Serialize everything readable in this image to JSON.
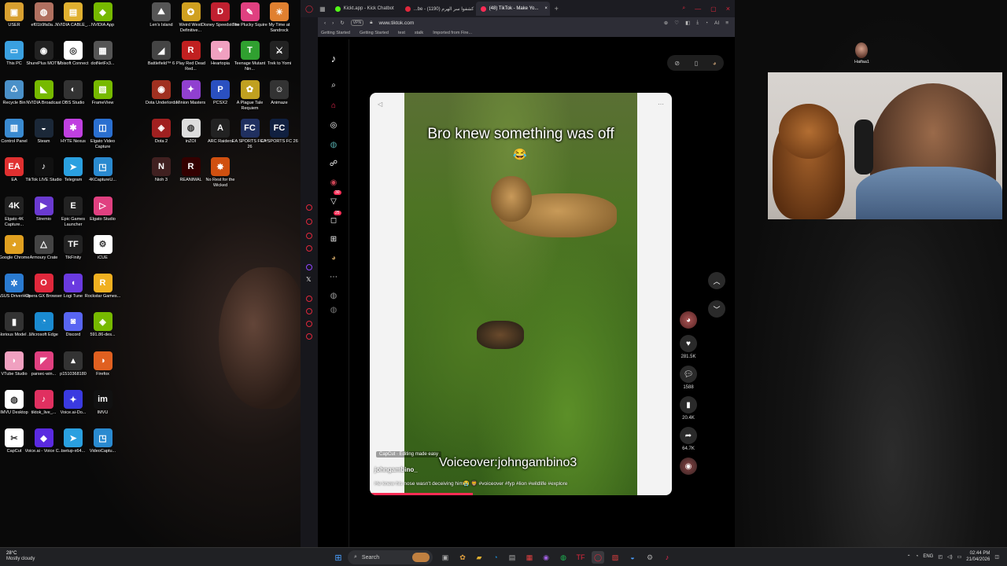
{
  "desktop": {
    "icons": [
      {
        "label": "USER",
        "color": "#d8a030",
        "glyph": "▣"
      },
      {
        "label": "ef01b9fa0a...",
        "color": "#b07060",
        "glyph": "◍"
      },
      {
        "label": "NVIDIA CABLE_...",
        "color": "#e0b030",
        "glyph": "▤"
      },
      {
        "label": "NVIDIA App",
        "color": "#76b900",
        "glyph": "◆"
      },
      {
        "label": "This PC",
        "color": "#3aa0e0",
        "glyph": "▭"
      },
      {
        "label": "ShurePlus MOTIV",
        "color": "#222",
        "glyph": "◉"
      },
      {
        "label": "Ubisoft Connect",
        "color": "#fff",
        "glyph": "◎"
      },
      {
        "label": "dotNetFx3...",
        "color": "#555",
        "glyph": "▦"
      },
      {
        "label": "Recycle Bin",
        "color": "#4a90c8",
        "glyph": "♺"
      },
      {
        "label": "NVIDIA Broadcast",
        "color": "#76b900",
        "glyph": "◣"
      },
      {
        "label": "OBS Studio",
        "color": "#333",
        "glyph": "◐"
      },
      {
        "label": "FrameView",
        "color": "#76b900",
        "glyph": "▧"
      },
      {
        "label": "Control Panel",
        "color": "#3a8ad0",
        "glyph": "▥"
      },
      {
        "label": "Steam",
        "color": "#1b2838",
        "glyph": "◒"
      },
      {
        "label": "HYTE Nexus",
        "color": "#c040e0",
        "glyph": "✱"
      },
      {
        "label": "Elgato Video Capture",
        "color": "#2a6fd0",
        "glyph": "◫"
      },
      {
        "label": "EA",
        "color": "#e03030",
        "glyph": "EA"
      },
      {
        "label": "TikTok LIVE Studio",
        "color": "#111",
        "glyph": "♪"
      },
      {
        "label": "Telegram",
        "color": "#2aa0e0",
        "glyph": "➤"
      },
      {
        "label": "4KCaptureU...",
        "color": "#2a8ad0",
        "glyph": "◳"
      },
      {
        "label": "Elgato 4K Capture...",
        "color": "#222",
        "glyph": "4K"
      },
      {
        "label": "Stremio",
        "color": "#6a3ad0",
        "glyph": "▶"
      },
      {
        "label": "Epic Games Launcher",
        "color": "#222",
        "glyph": "E"
      },
      {
        "label": "Elgato Studio",
        "color": "#e04080",
        "glyph": "▷"
      },
      {
        "label": "Google Chrome",
        "color": "#e0a020",
        "glyph": "◕"
      },
      {
        "label": "Armoury Crate",
        "color": "#444",
        "glyph": "△"
      },
      {
        "label": "TikFinity",
        "color": "#222",
        "glyph": "TF"
      },
      {
        "label": "iCUE",
        "color": "#fff",
        "glyph": "⚙"
      },
      {
        "label": "ASUS DriverHub",
        "color": "#2a7ad0",
        "glyph": "✲"
      },
      {
        "label": "Opera GX Browser",
        "color": "#e0283c",
        "glyph": "O"
      },
      {
        "label": "Logi Tune",
        "color": "#6a3ae0",
        "glyph": "◖"
      },
      {
        "label": "Rockstar Games...",
        "color": "#f0b020",
        "glyph": "R"
      },
      {
        "label": "Glorious Model ...",
        "color": "#333",
        "glyph": "▮"
      },
      {
        "label": "Microsoft Edge",
        "color": "#1a8ad0",
        "glyph": "◔"
      },
      {
        "label": "Discord",
        "color": "#5865f2",
        "glyph": "◙"
      },
      {
        "label": "591.86-des...",
        "color": "#76b900",
        "glyph": "◈"
      },
      {
        "label": "VTube Studio",
        "color": "#f0a0c0",
        "glyph": "◗"
      },
      {
        "label": "parsec-win...",
        "color": "#e04080",
        "glyph": "◤"
      },
      {
        "label": "p1510368180",
        "color": "#333",
        "glyph": "▴"
      },
      {
        "label": "Firefox",
        "color": "#e06020",
        "glyph": "◑"
      },
      {
        "label": "IMVU Desktop",
        "color": "#fff",
        "glyph": "◍"
      },
      {
        "label": "tiktok_live_...",
        "color": "#e03060",
        "glyph": "♪"
      },
      {
        "label": "Voice.ai-Do...",
        "color": "#3a3ae0",
        "glyph": "✦"
      },
      {
        "label": "IMVU",
        "color": "#111",
        "glyph": "im"
      },
      {
        "label": "CapCut",
        "color": "#fff",
        "glyph": "✂"
      },
      {
        "label": "Voice.ai - Voice C...",
        "color": "#5a2ae0",
        "glyph": "◆"
      },
      {
        "label": "tsetup-x64...",
        "color": "#2aa0e0",
        "glyph": "➤"
      },
      {
        "label": "VideoCaptu...",
        "color": "#2a8ad0",
        "glyph": "◳"
      }
    ],
    "icons2": [
      {
        "label": "Len's Island",
        "color": "#555",
        "glyph": "⛰"
      },
      {
        "label": "Weird West: Definitive...",
        "color": "#d0a020",
        "glyph": "✪"
      },
      {
        "label": "Disney Speedstorm",
        "color": "#c02030",
        "glyph": "D"
      },
      {
        "label": "The Plucky Squire",
        "color": "#e04080",
        "glyph": "✎"
      },
      {
        "label": "My Time at Sandrock",
        "color": "#e08030",
        "glyph": "☀"
      },
      {
        "label": "Battlefield™ 6",
        "color": "#444",
        "glyph": "◢"
      },
      {
        "label": "Play Red Dead Red...",
        "color": "#c02020",
        "glyph": "R"
      },
      {
        "label": "Heartopia",
        "color": "#f0a0c0",
        "glyph": "♥"
      },
      {
        "label": "Teenage Mutant Nin...",
        "color": "#30a030",
        "glyph": "T"
      },
      {
        "label": "Trek to Yomi",
        "color": "#222",
        "glyph": "⚔"
      },
      {
        "label": "Dota Underlords",
        "color": "#a03020",
        "glyph": "◉"
      },
      {
        "label": "Minion Masters",
        "color": "#9040d0",
        "glyph": "✦"
      },
      {
        "label": "PCSX2",
        "color": "#2a50c0",
        "glyph": "P"
      },
      {
        "label": "A Plague Tale Requiem",
        "color": "#c0a020",
        "glyph": "✿"
      },
      {
        "label": "Animaze",
        "color": "#333",
        "glyph": "☺"
      },
      {
        "label": "Dota 2",
        "color": "#a02020",
        "glyph": "◈"
      },
      {
        "label": "inZOI",
        "color": "#ddd",
        "glyph": "◍"
      },
      {
        "label": "ARC Raiders",
        "color": "#222",
        "glyph": "A"
      },
      {
        "label": "EA SPORTS FC™ 26",
        "color": "#203060",
        "glyph": "FC"
      },
      {
        "label": "EA SPORTS FC 26",
        "color": "#102040",
        "glyph": "FC"
      },
      {
        "label": "Nioh 3",
        "color": "#402020",
        "glyph": "N"
      },
      {
        "label": "REANIMAL",
        "color": "#300",
        "glyph": "R"
      },
      {
        "label": "No Rest for the Wicked",
        "color": "#d05010",
        "glyph": "✸"
      }
    ]
  },
  "browser": {
    "tabs": [
      {
        "label": "Kickt.app - Kick Chatbot",
        "dot": "#53fc18"
      },
      {
        "label": "...be - كشفوا سر الهرم (1190)",
        "dot": "#e0283c"
      },
      {
        "label": "(48) TikTok - Make Yo...",
        "dot": "#fe2c55"
      }
    ],
    "url": "www.tiktok.com",
    "vpn": "VPN",
    "bookmarks": [
      "Getting Started",
      "Getting Started",
      "test",
      "stalk",
      "Imported from Fire..."
    ],
    "ai_label": "AI"
  },
  "tiktok": {
    "nav_icons": [
      {
        "name": "search-icon",
        "glyph": "⌕"
      },
      {
        "name": "home-icon",
        "glyph": "⌂"
      },
      {
        "name": "explore-icon",
        "glyph": "◎"
      },
      {
        "name": "following-icon",
        "glyph": "◍"
      },
      {
        "name": "friends-icon",
        "glyph": "☍"
      },
      {
        "name": "live-icon",
        "glyph": "◉"
      },
      {
        "name": "activity-icon",
        "glyph": "▽"
      },
      {
        "name": "messages-icon",
        "glyph": "◻"
      },
      {
        "name": "upload-icon",
        "glyph": "⊞"
      },
      {
        "name": "profile-icon",
        "glyph": "◕"
      },
      {
        "name": "more-icon",
        "glyph": "⋯"
      }
    ],
    "activity_badge": "30",
    "messages_badge": "25",
    "video": {
      "overlay_title": "Bro knew something was off",
      "emoji": "😂",
      "voiceover": "Voiceover:johngambino3",
      "capcut": "CapCut · Editing made easy",
      "author": "johngambino_",
      "description": "He knew his nose wasn't deceiving him😭 🦁 #voiceover #fyp #lion #wildlife #explore",
      "progress": 0.34
    },
    "actions": {
      "likes": "281.5K",
      "comments": "1588",
      "saves": "20.4K",
      "shares": "64.7K"
    }
  },
  "stream": {
    "follower_name": "Haifaa1"
  },
  "taskbar": {
    "temperature": "28°C",
    "weather": "Mostly cloudy",
    "search_placeholder": "Search",
    "language": "ENG",
    "time": "02:44 PM",
    "date": "21/04/2026"
  }
}
